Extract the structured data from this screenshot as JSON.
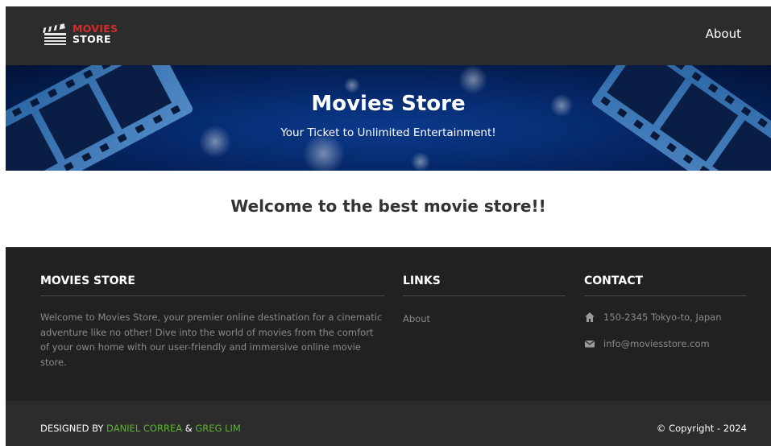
{
  "navbar": {
    "logo_line1": "MOVIES",
    "logo_line2": "STORE",
    "logo_icon": "clapperboard-icon",
    "about_link": "About"
  },
  "hero": {
    "title": "Movies Store",
    "subtitle": "Your Ticket to Unlimited Entertainment!"
  },
  "main": {
    "welcome": "Welcome to the best movie store!!"
  },
  "footer": {
    "about": {
      "heading": "MOVIES STORE",
      "text": "Welcome to Movies Store, your premier online destination for a cinematic adventure like no other! Dive into the world of movies from the comfort of your own home with our user-friendly and immersive online movie store."
    },
    "links": {
      "heading": "LINKS",
      "items": [
        "About"
      ]
    },
    "contact": {
      "heading": "CONTACT",
      "address": "150-2345 Tokyo-to, Japan",
      "address_icon": "home-icon",
      "email": "info@moviesstore.com",
      "email_icon": "envelope-icon"
    }
  },
  "bottom": {
    "designed_by": "DESIGNED BY",
    "author1": "DANIEL CORREA",
    "separator": "&",
    "author2": "GREG LIM",
    "copyright": "© Copyright - 2024"
  },
  "colors": {
    "navbar_bg": "#2c2c2c",
    "footer_bg": "#212121",
    "logo_red": "#d32b2b",
    "author_green": "#5fb332",
    "hero_blue": "#062a6e"
  }
}
